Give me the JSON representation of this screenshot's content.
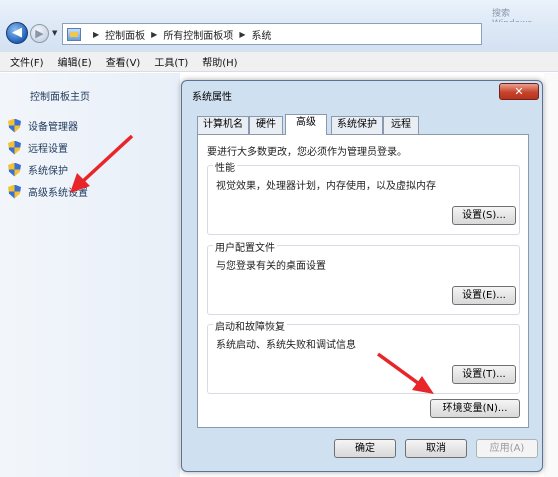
{
  "window": {
    "search_placeholder": "搜索 Windows"
  },
  "address": {
    "crumbs": [
      "控制面板",
      "所有控制面板项",
      "系统"
    ]
  },
  "menu": {
    "items": [
      "文件(F)",
      "编辑(E)",
      "查看(V)",
      "工具(T)",
      "帮助(H)"
    ]
  },
  "sidebar": {
    "home": "控制面板主页",
    "links": [
      "设备管理器",
      "远程设置",
      "系统保护",
      "高级系统设置"
    ]
  },
  "dialog": {
    "title": "系统属性",
    "close_symbol": "✕",
    "tabs": [
      "计算机名",
      "硬件",
      "高级",
      "系统保护",
      "远程"
    ],
    "active_tab": "高级",
    "admin_note": "要进行大多数更改，您必须作为管理员登录。",
    "groups": [
      {
        "title": "性能",
        "desc": "视觉效果，处理器计划，内存使用，以及虚拟内存",
        "button": "设置(S)..."
      },
      {
        "title": "用户配置文件",
        "desc": "与您登录有关的桌面设置",
        "button": "设置(E)..."
      },
      {
        "title": "启动和故障恢复",
        "desc": "系统启动、系统失败和调试信息",
        "button": "设置(T)..."
      }
    ],
    "env_button": "环境变量(N)...",
    "ok": "确定",
    "cancel": "取消",
    "apply": "应用(A)"
  },
  "colors": {
    "annotation_arrow": "#e8262a",
    "dialog_frame": "#cfe0f1",
    "link_text": "#1e395b"
  }
}
